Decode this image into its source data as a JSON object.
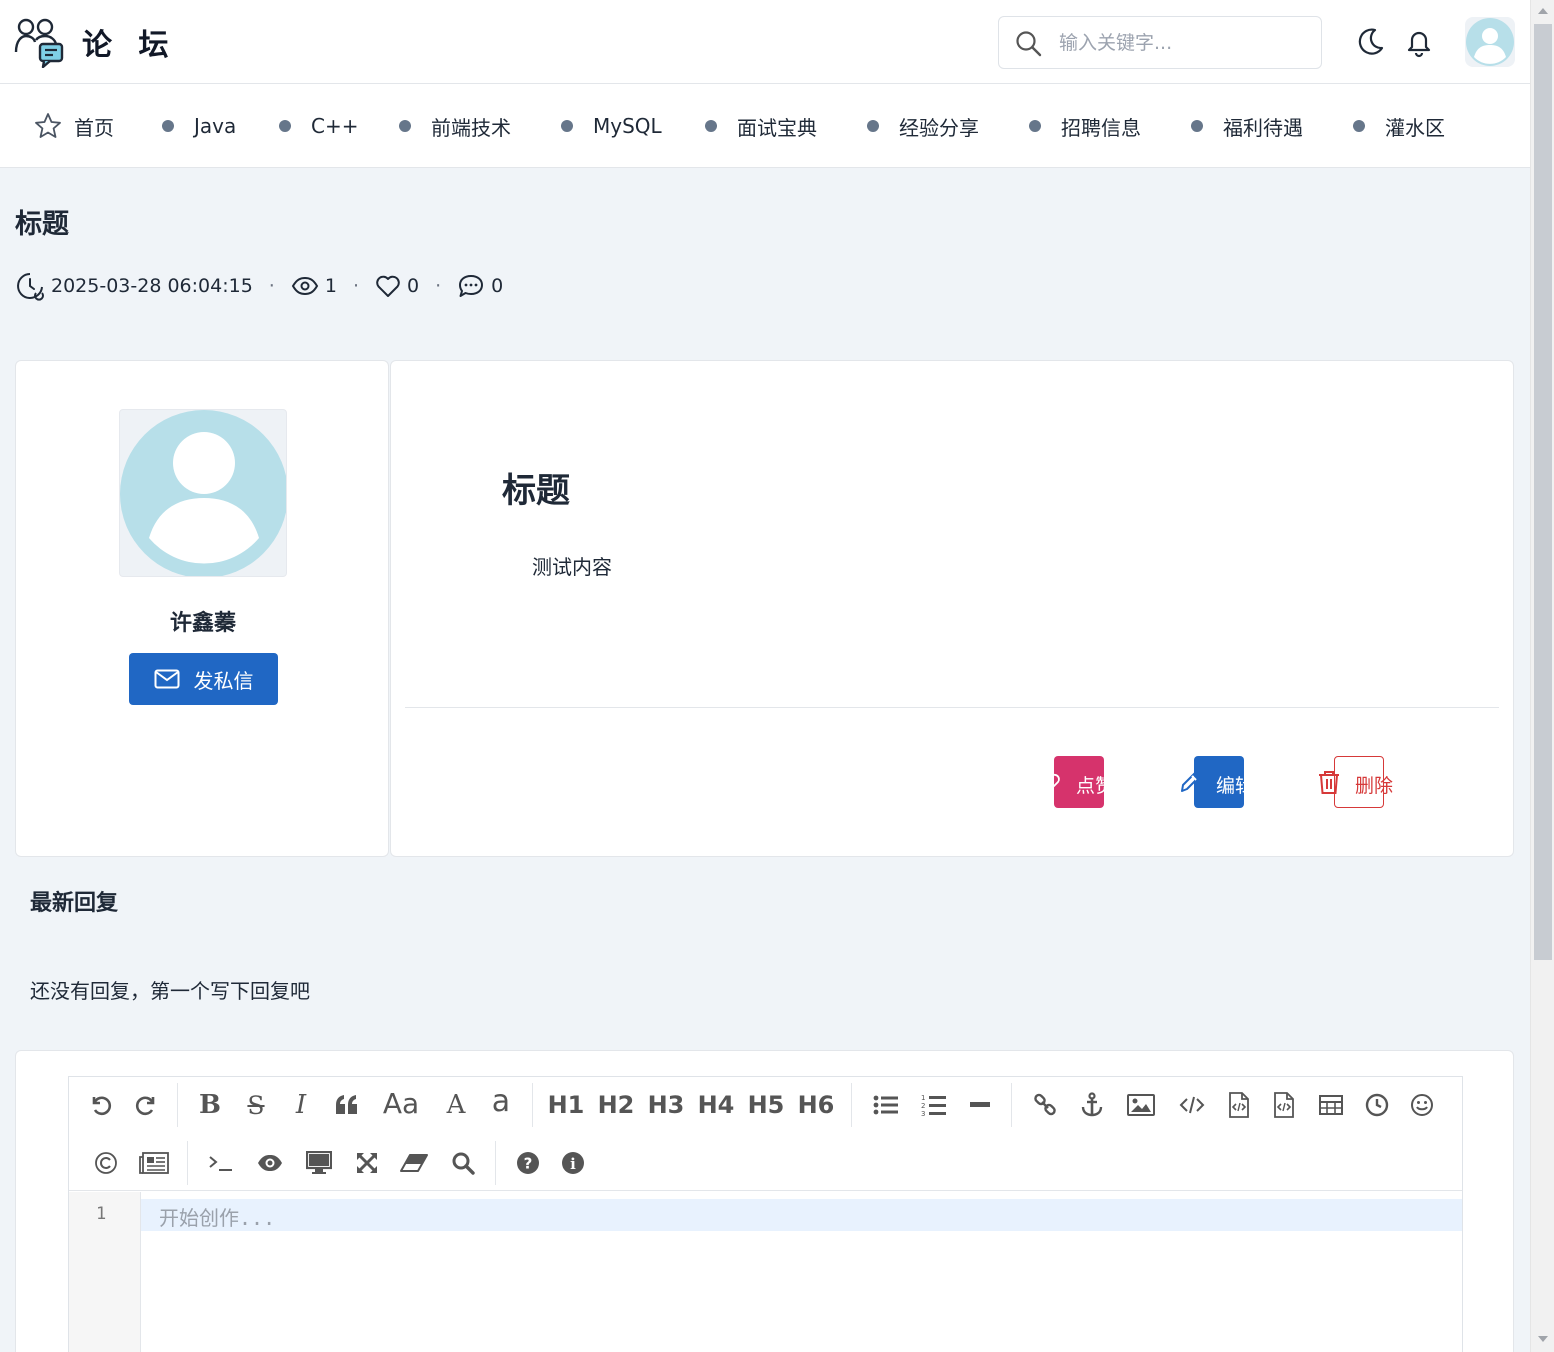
{
  "header": {
    "logo_text": "论 坛",
    "search_placeholder": "输入关键字..."
  },
  "nav": {
    "items": [
      {
        "label": "首页",
        "icon": "star-icon"
      },
      {
        "label": "Java"
      },
      {
        "label": "C++"
      },
      {
        "label": "前端技术"
      },
      {
        "label": "MySQL"
      },
      {
        "label": "面试宝典"
      },
      {
        "label": "经验分享"
      },
      {
        "label": "招聘信息"
      },
      {
        "label": "福利待遇"
      },
      {
        "label": "灌水区"
      }
    ]
  },
  "post": {
    "page_title": "标题",
    "datetime": "2025-03-28 06:04:15",
    "views": "1",
    "likes": "0",
    "comments": "0",
    "title": "标题",
    "content": "测试内容",
    "actions": {
      "like_label": "点赞",
      "edit_label": "编辑",
      "delete_label": "删除"
    }
  },
  "author": {
    "name": "许鑫蓁",
    "message_button": "发私信"
  },
  "replies": {
    "title": "最新回复",
    "empty_text": "还没有回复，第一个写下回复吧"
  },
  "editor": {
    "headings": [
      "H1",
      "H2",
      "H3",
      "H4",
      "H5",
      "H6"
    ],
    "line_number": "1",
    "placeholder": "开始创作..."
  },
  "colors": {
    "primary": "#2067c4",
    "like": "#d6336c",
    "danger": "#d63939",
    "avatar": "#b7dfe9",
    "page_bg": "#f0f4f8"
  }
}
